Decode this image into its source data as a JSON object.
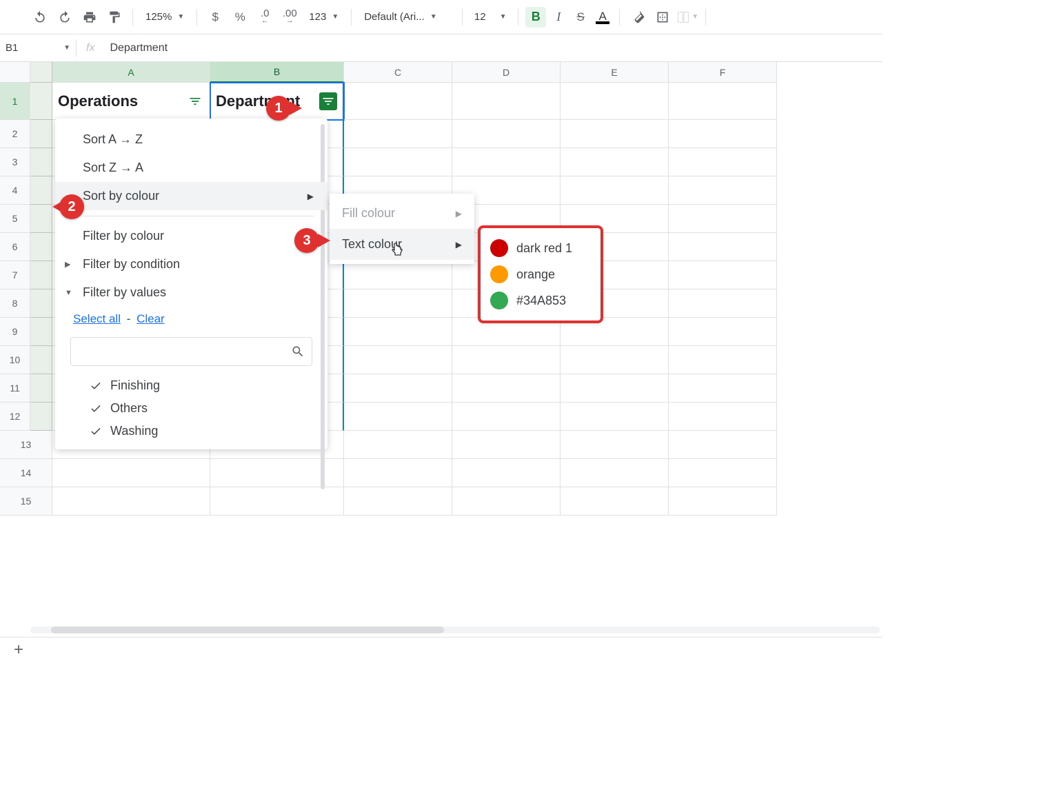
{
  "toolbar": {
    "zoom": "125%",
    "currency": "$",
    "percent": "%",
    "dec_dec": ".0",
    "dec_inc": ".00",
    "numfmt": "123",
    "font": "Default (Ari...",
    "font_size": "12",
    "bold": "B",
    "italic": "I",
    "strike": "S",
    "text_color": "A"
  },
  "formula": {
    "name_box": "B1",
    "fx": "fx",
    "value": "Department"
  },
  "columns": [
    "A",
    "B",
    "C",
    "D",
    "E",
    "F"
  ],
  "col_widths": {
    "A": 229,
    "B": 194,
    "std": 157
  },
  "rows": [
    "1",
    "2",
    "3",
    "4",
    "5",
    "6",
    "7",
    "8",
    "9",
    "10",
    "11",
    "12",
    "13",
    "14",
    "15"
  ],
  "headers": {
    "a1": "Operations",
    "b1": "Department"
  },
  "filter_menu": {
    "sort_az": "Sort A → Z",
    "sort_za": "Sort Z → A",
    "sort_colour": "Sort by colour",
    "filter_colour": "Filter by colour",
    "filter_condition": "Filter by condition",
    "filter_values": "Filter by values",
    "select_all": "Select all",
    "dash": " - ",
    "clear": "Clear",
    "values": [
      "Finishing",
      "Others",
      "Washing"
    ]
  },
  "submenu": {
    "fill": "Fill colour",
    "text": "Text colour"
  },
  "colors": [
    {
      "name": "dark red 1",
      "hex": "#cc0000"
    },
    {
      "name": "orange",
      "hex": "#ff9900"
    },
    {
      "name": "#34A853",
      "hex": "#34A853"
    }
  ],
  "callouts": {
    "1": "1",
    "2": "2",
    "3": "3"
  },
  "sheet_bar": {
    "add": "+"
  }
}
